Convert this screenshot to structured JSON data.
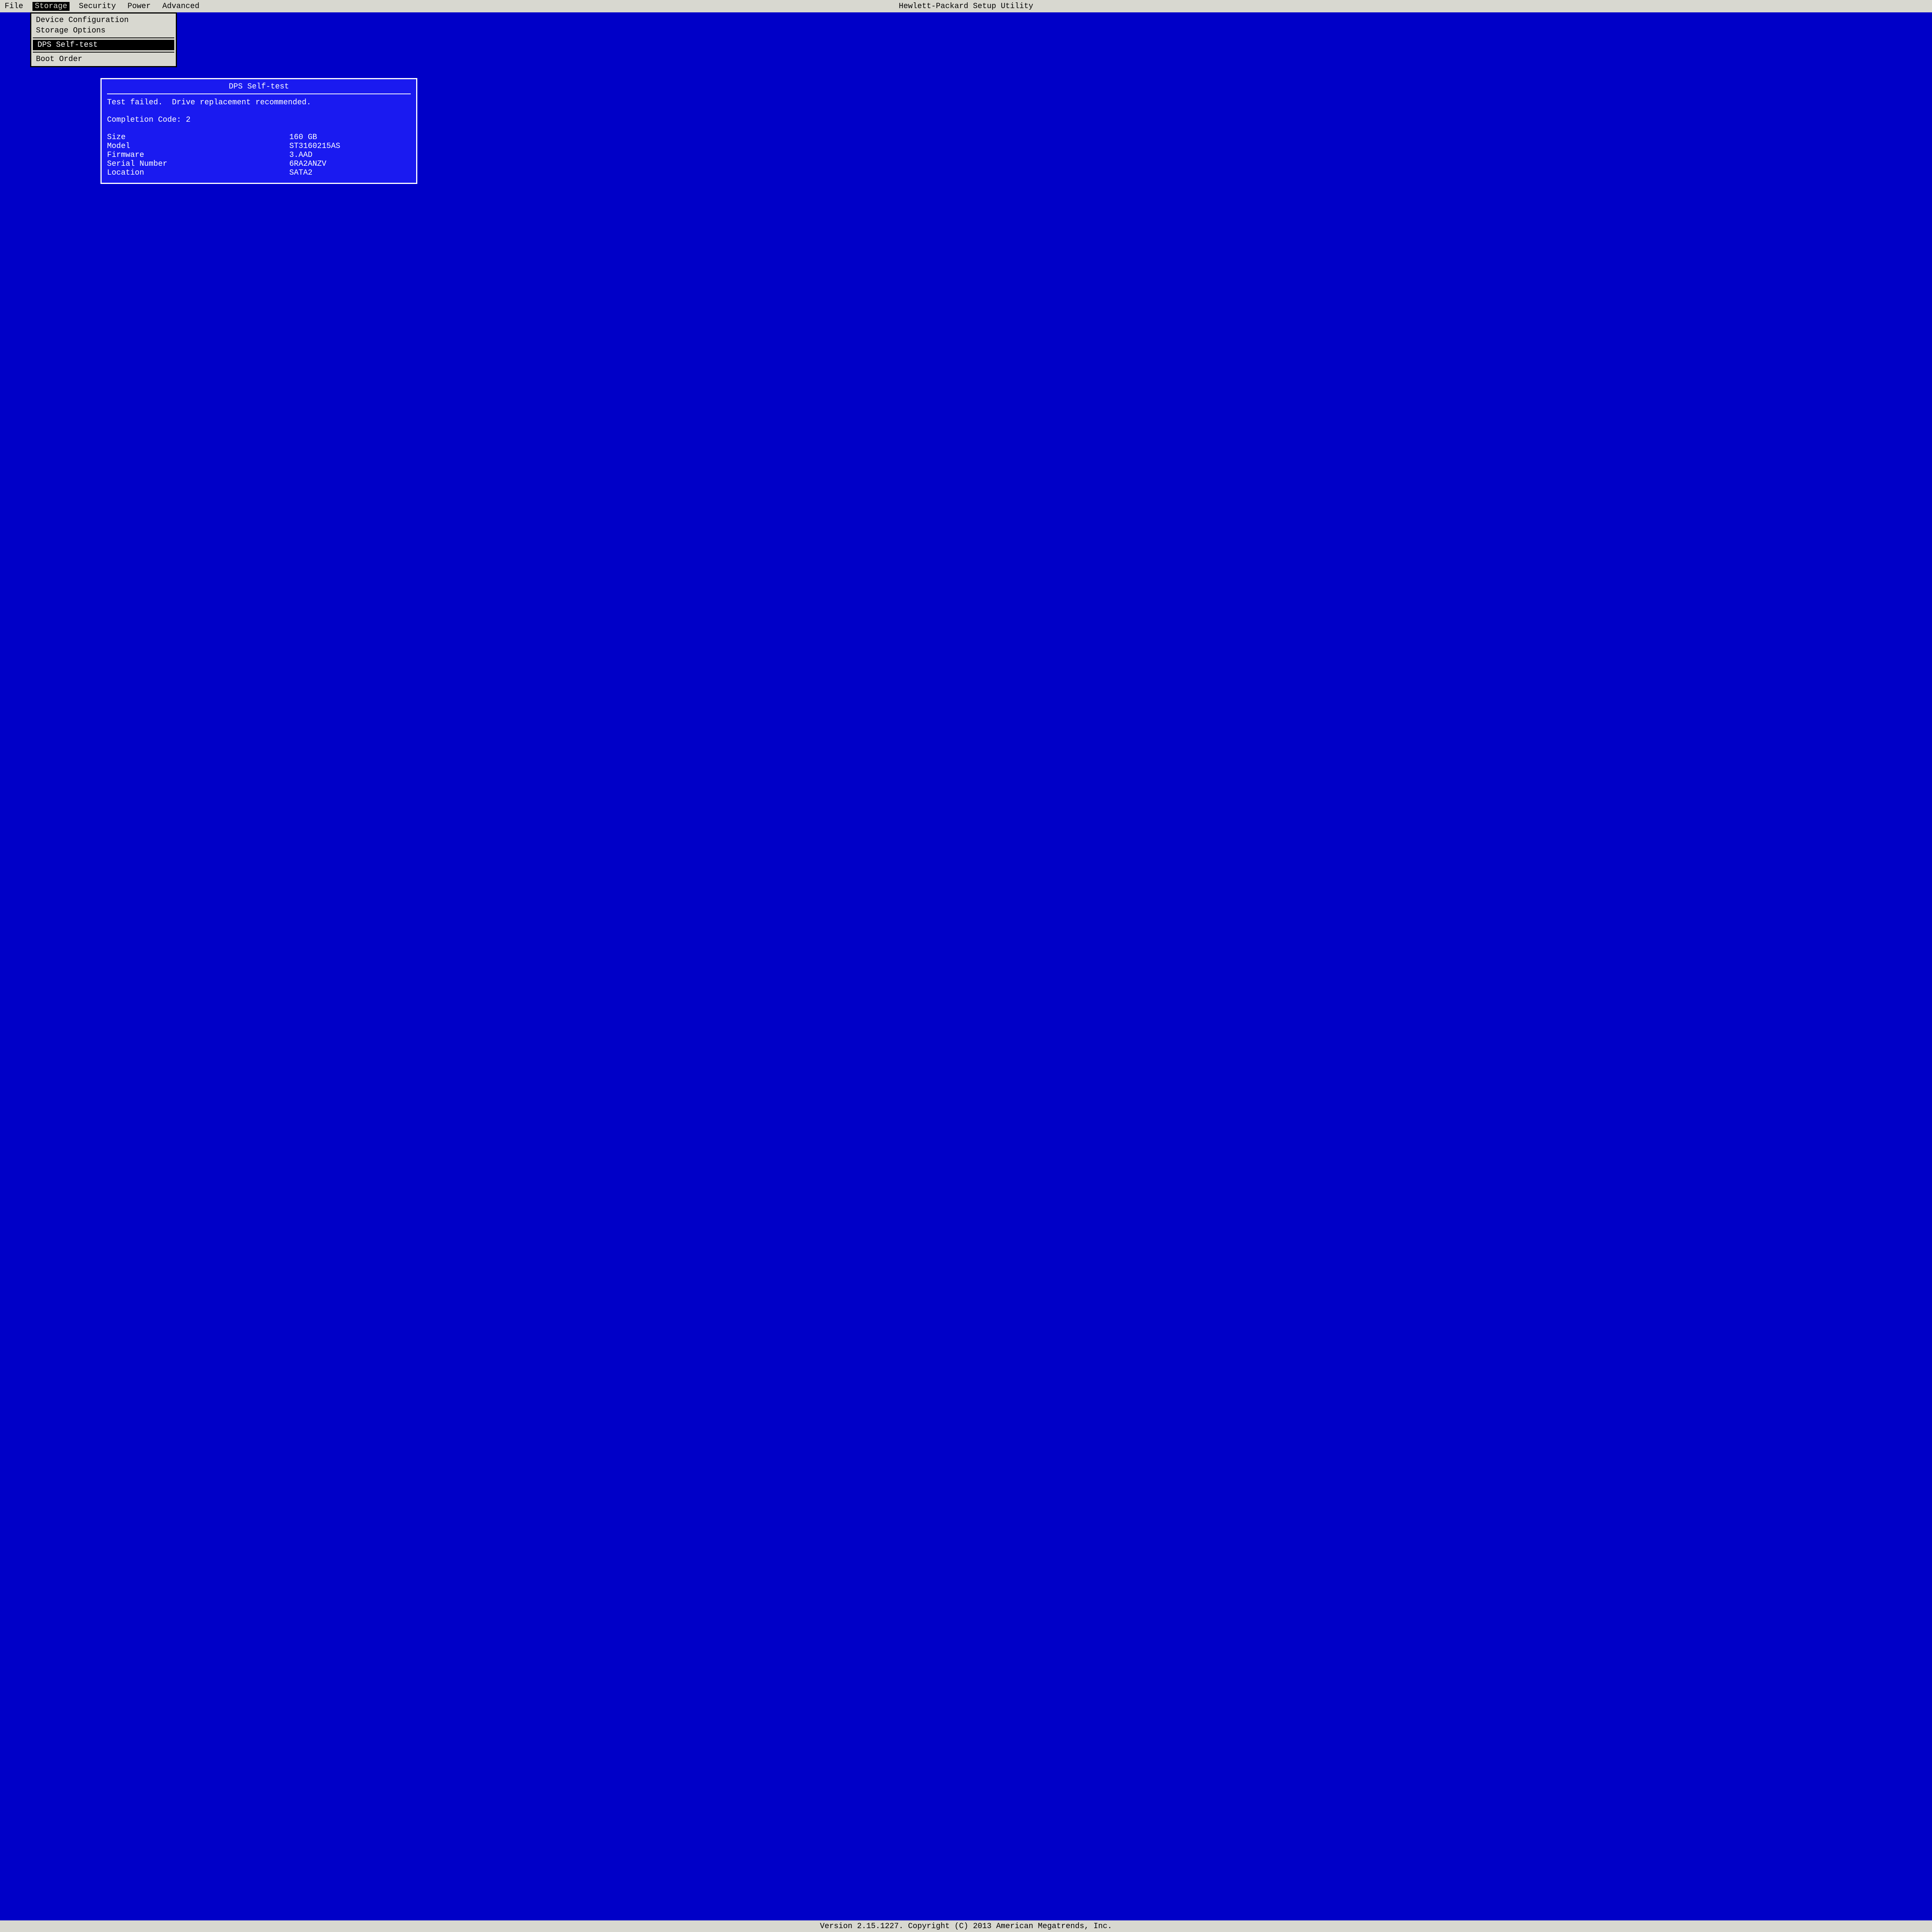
{
  "header": {
    "title": "Hewlett-Packard Setup Utility",
    "menus": {
      "file": "File",
      "storage": "Storage",
      "security": "Security",
      "power": "Power",
      "advanced": "Advanced"
    }
  },
  "dropdown": {
    "device_configuration": "Device Configuration",
    "storage_options": "Storage Options",
    "dps_self_test": "DPS Self-test",
    "boot_order": "Boot Order"
  },
  "dialog": {
    "title": "DPS Self-test",
    "message": "Test failed.  Drive replacement recommended.",
    "completion_code_label": "Completion Code: 2",
    "fields": {
      "size": {
        "label": "Size",
        "value": "160 GB"
      },
      "model": {
        "label": "Model",
        "value": "ST3160215AS"
      },
      "firmware": {
        "label": "Firmware",
        "value": "3.AAD"
      },
      "serial": {
        "label": "Serial Number",
        "value": "6RA2ANZV"
      },
      "location": {
        "label": "Location",
        "value": "SATA2"
      }
    }
  },
  "footer": {
    "text": "Version 2.15.1227. Copyright (C) 2013 American Megatrends, Inc."
  }
}
